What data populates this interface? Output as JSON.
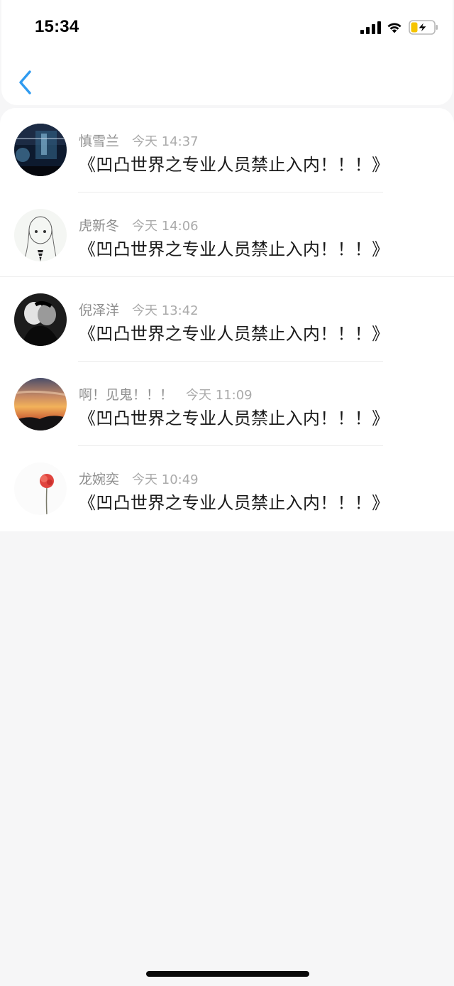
{
  "status_bar": {
    "time": "15:34",
    "signal_icon": "cellular-signal-icon",
    "wifi_icon": "wifi-icon",
    "battery_icon": "battery-charging-icon",
    "battery_color": "#f5c400"
  },
  "nav": {
    "back_icon": "chevron-left-icon",
    "accent_color": "#2f9bf0"
  },
  "messages": [
    {
      "name": "慎雪兰",
      "time": "今天 14:37",
      "text": "《凹凸世界之专业人员禁止入内！！！》",
      "avatar": "night-sky-photo"
    },
    {
      "name": "虎新冬",
      "time": "今天 14:06",
      "text": "《凹凸世界之专业人员禁止入内！！！》",
      "avatar": "sketch-girl-drawing"
    },
    {
      "name": "倪泽洋",
      "time": "今天 13:42",
      "text": "《凹凸世界之专业人员禁止入内！！！》",
      "avatar": "couple-dark-photo"
    },
    {
      "name": "啊！见鬼！！！",
      "time": "今天 11:09",
      "text": "《凹凸世界之专业人员禁止入内！！！》",
      "avatar": "sunset-photo"
    },
    {
      "name": "龙婉奕",
      "time": "今天 10:49",
      "text": "《凹凸世界之专业人员禁止入内！！！》",
      "avatar": "red-flower-photo"
    }
  ]
}
